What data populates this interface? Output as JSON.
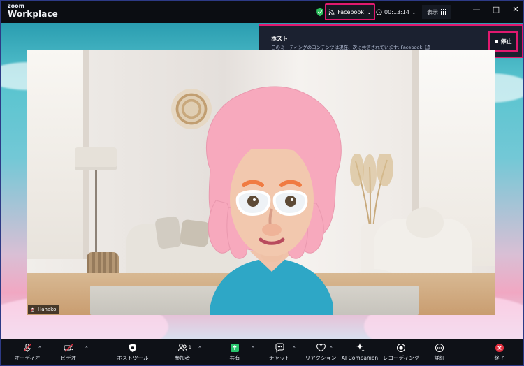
{
  "window": {
    "brand_small": "zoom",
    "brand_big": "Workplace",
    "controls": {
      "minimize": "—",
      "maximize": "□",
      "close": "✕"
    }
  },
  "header": {
    "facebook_label": "Facebook",
    "timer": "00:13:14",
    "view_label": "表示"
  },
  "notification": {
    "title": "ホスト",
    "message": "このミーティングのコンテンツは現在、次に共信されています: Facebook",
    "stop_label": "停止"
  },
  "video": {
    "participant_name": "Hanako"
  },
  "toolbar": {
    "items": [
      {
        "label": "オーディオ"
      },
      {
        "label": "ビデオ"
      },
      {
        "label": "ホストツール"
      },
      {
        "label": "参加者",
        "badge": "1"
      },
      {
        "label": "共有"
      },
      {
        "label": "チャット"
      },
      {
        "label": "リアクション"
      },
      {
        "label": "AI Companion"
      },
      {
        "label": "レコーディング"
      },
      {
        "label": "詳細"
      },
      {
        "label": "終了"
      }
    ]
  },
  "colors": {
    "accent": "#e0196f",
    "share_green": "#29c56e",
    "end_red": "#e02f3f"
  },
  "icons": {
    "security": "shield-check-icon",
    "rss": "rss-icon",
    "clock": "clock-icon",
    "grid": "grid-icon",
    "external_link": "external-link-icon",
    "stop": "stop-icon"
  }
}
